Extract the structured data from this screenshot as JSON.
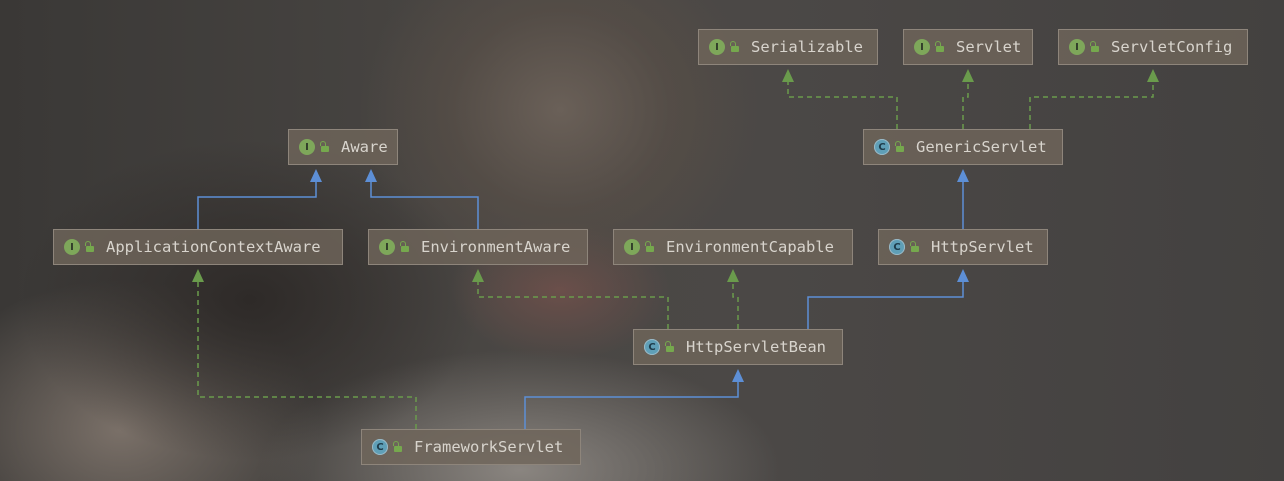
{
  "diagram": {
    "nodes": [
      {
        "id": "serializable",
        "label": "Serializable",
        "kind": "interface"
      },
      {
        "id": "servlet",
        "label": "Servlet",
        "kind": "interface"
      },
      {
        "id": "servletconfig",
        "label": "ServletConfig",
        "kind": "interface"
      },
      {
        "id": "aware",
        "label": "Aware",
        "kind": "interface"
      },
      {
        "id": "genericservlet",
        "label": "GenericServlet",
        "kind": "class"
      },
      {
        "id": "applicationcontextaware",
        "label": "ApplicationContextAware",
        "kind": "interface"
      },
      {
        "id": "environmentaware",
        "label": "EnvironmentAware",
        "kind": "interface"
      },
      {
        "id": "environmentcapable",
        "label": "EnvironmentCapable",
        "kind": "interface"
      },
      {
        "id": "httpservlet",
        "label": "HttpServlet",
        "kind": "class"
      },
      {
        "id": "httpservletbean",
        "label": "HttpServletBean",
        "kind": "class"
      },
      {
        "id": "frameworkservlet",
        "label": "FrameworkServlet",
        "kind": "class"
      }
    ],
    "edges": [
      {
        "from": "genericservlet",
        "to": "serializable",
        "type": "implements"
      },
      {
        "from": "genericservlet",
        "to": "servlet",
        "type": "implements"
      },
      {
        "from": "genericservlet",
        "to": "servletconfig",
        "type": "implements"
      },
      {
        "from": "httpservlet",
        "to": "genericservlet",
        "type": "extends"
      },
      {
        "from": "applicationcontextaware",
        "to": "aware",
        "type": "extends"
      },
      {
        "from": "environmentaware",
        "to": "aware",
        "type": "extends"
      },
      {
        "from": "httpservletbean",
        "to": "environmentaware",
        "type": "implements"
      },
      {
        "from": "httpservletbean",
        "to": "environmentcapable",
        "type": "implements"
      },
      {
        "from": "httpservletbean",
        "to": "httpservlet",
        "type": "extends"
      },
      {
        "from": "frameworkservlet",
        "to": "applicationcontextaware",
        "type": "implements"
      },
      {
        "from": "frameworkservlet",
        "to": "httpservletbean",
        "type": "extends"
      }
    ],
    "badge_letters": {
      "interface": "I",
      "class": "C"
    },
    "colors": {
      "interface_badge": "#7ea75a",
      "class_badge": "#5f9fb7",
      "implements_edge": "#6a9b4c",
      "extends_edge": "#5d8fd6",
      "node_fill": "#6f655a",
      "node_text": "#d8d4cd"
    }
  }
}
